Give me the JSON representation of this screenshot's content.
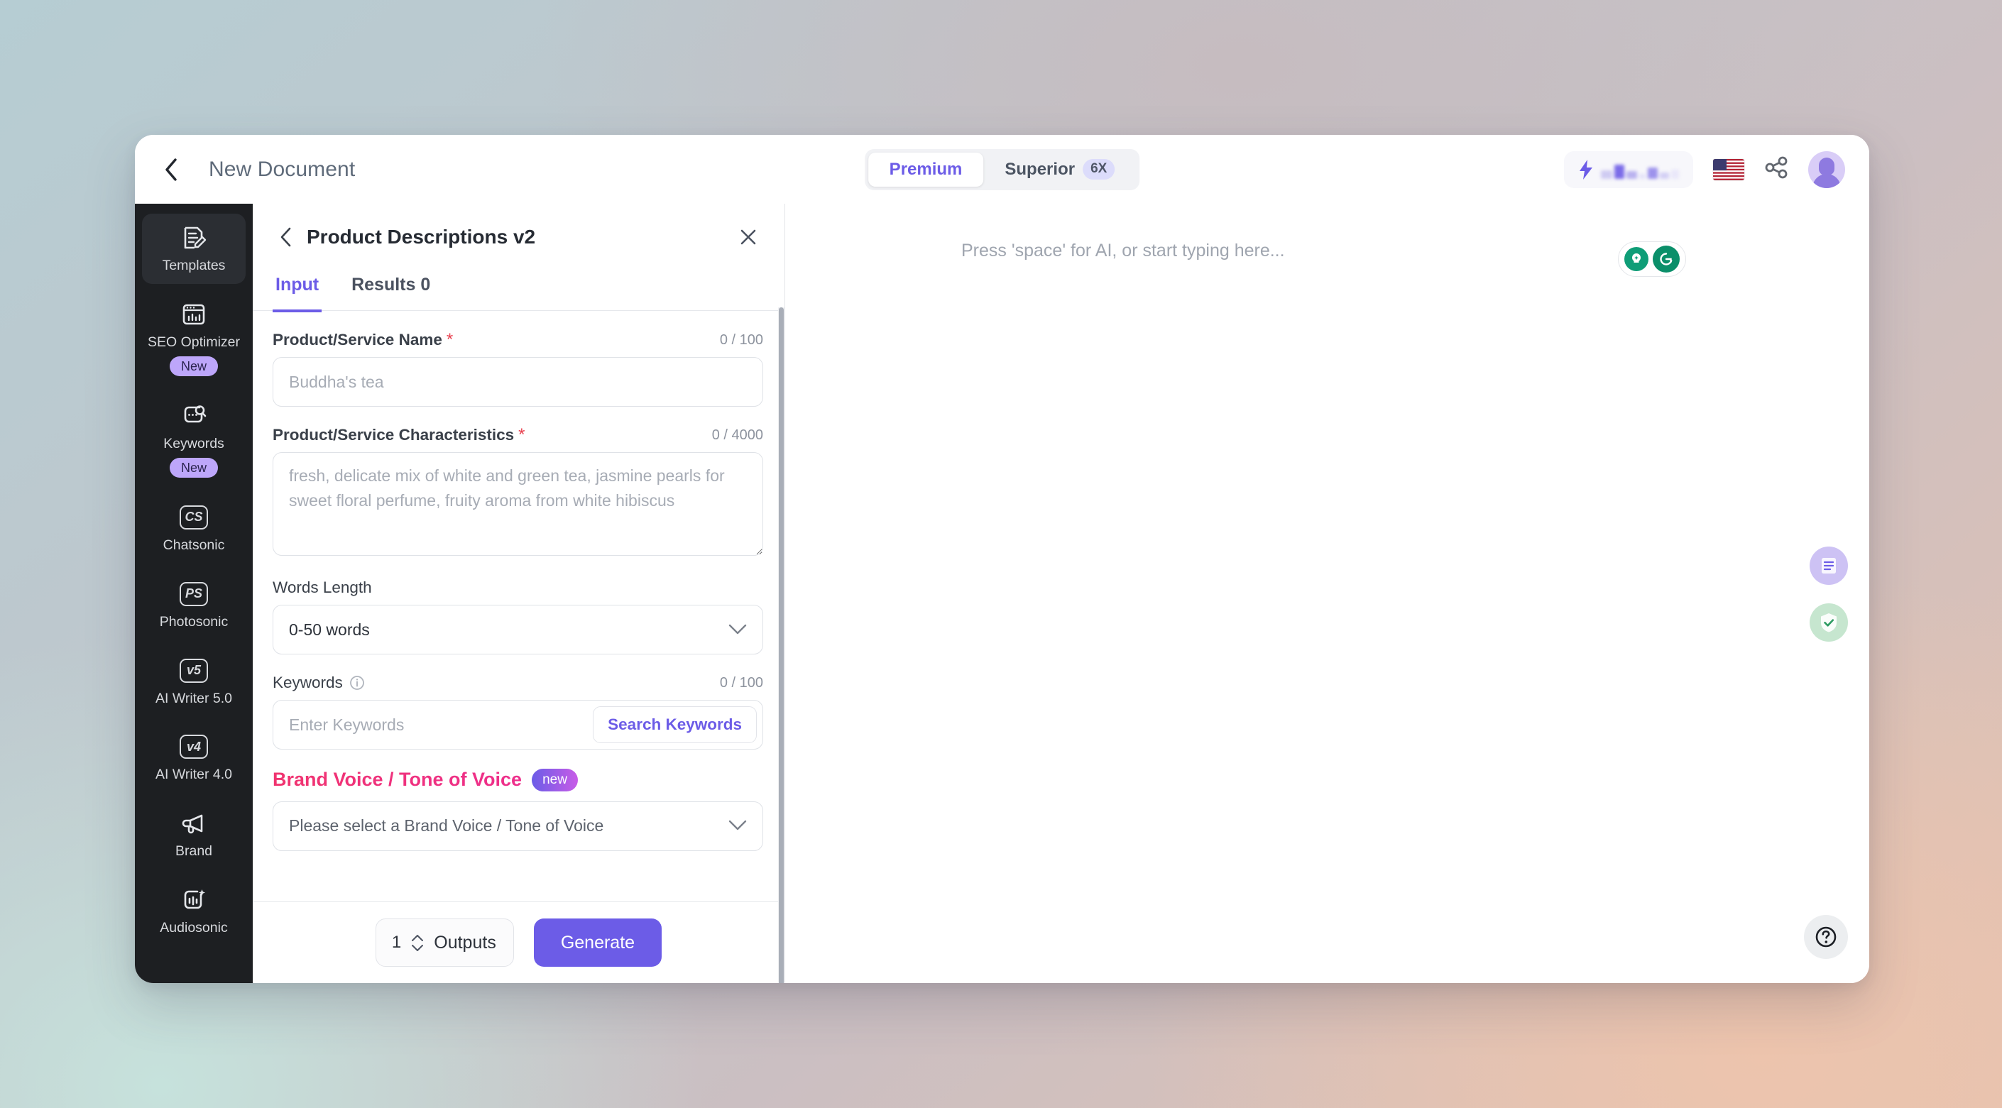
{
  "topbar": {
    "back_icon": "chevron-left-icon",
    "title": "New Document",
    "segments": [
      {
        "label": "Premium",
        "badge": "",
        "active": true
      },
      {
        "label": "Superior",
        "badge": "6X",
        "active": false
      }
    ],
    "credits_icon": "lightning-bolt-icon",
    "flag_icon": "us-flag-icon",
    "share_icon": "share-icon",
    "avatar_icon": "user-avatar"
  },
  "sidebar": {
    "items": [
      {
        "label": "Templates",
        "icon": "document-edit-icon",
        "badge": "",
        "active": true
      },
      {
        "label": "SEO Optimizer",
        "icon": "seo-chart-window-icon",
        "badge": "New",
        "active": false
      },
      {
        "label": "Keywords",
        "icon": "keyword-search-icon",
        "badge": "New",
        "active": false
      },
      {
        "label": "Chatsonic",
        "icon": "cs-box-icon",
        "glyph": "CS",
        "badge": "",
        "active": false
      },
      {
        "label": "Photosonic",
        "icon": "ps-box-icon",
        "glyph": "PS",
        "badge": "",
        "active": false
      },
      {
        "label": "AI Writer 5.0",
        "icon": "v5-box-icon",
        "glyph": "v5",
        "badge": "",
        "active": false
      },
      {
        "label": "AI Writer 4.0",
        "icon": "v4-box-icon",
        "glyph": "v4",
        "badge": "",
        "active": false
      },
      {
        "label": "Brand",
        "icon": "megaphone-icon",
        "badge": "",
        "active": false
      },
      {
        "label": "Audiosonic",
        "icon": "audio-sparkle-icon",
        "badge": "",
        "active": false
      }
    ]
  },
  "panel": {
    "back_icon": "chevron-left-icon",
    "title": "Product Descriptions v2",
    "close_icon": "close-icon",
    "tabs": [
      {
        "label": "Input",
        "active": true
      },
      {
        "label": "Results 0",
        "active": false
      }
    ],
    "fields": {
      "product_name": {
        "label": "Product/Service Name",
        "required": "*",
        "counter": "0 / 100",
        "value": "",
        "placeholder": "Buddha's tea"
      },
      "characteristics": {
        "label": "Product/Service Characteristics",
        "required": "*",
        "counter": "0 / 4000",
        "value": "",
        "placeholder": "fresh, delicate mix of white and green tea, jasmine pearls for sweet floral perfume, fruity aroma from white hibiscus"
      },
      "words_length": {
        "label": "Words Length",
        "value": "0-50 words",
        "chevron_icon": "chevron-down-icon"
      },
      "keywords": {
        "label": "Keywords",
        "info_icon": "info-icon",
        "counter": "0 / 100",
        "value": "",
        "placeholder": "Enter Keywords",
        "search_button": "Search Keywords"
      },
      "brand_voice": {
        "label": "Brand Voice / Tone of Voice",
        "badge": "new",
        "value": "Please select a Brand Voice / Tone of Voice",
        "chevron_icon": "chevron-down-icon"
      }
    },
    "footer": {
      "outputs_count": "1",
      "outputs_label": "Outputs",
      "stepper_up_icon": "chevron-up-icon",
      "stepper_down_icon": "chevron-down-icon",
      "generate_label": "Generate"
    }
  },
  "editor": {
    "placeholder": "Press 'space' for AI, or start typing here...",
    "assist_bulb_icon": "lightbulb-sparkle-icon",
    "assist_grammarly_icon": "grammarly-g-icon",
    "fabs": [
      {
        "icon": "summarize-document-icon",
        "color": "#cdc2f4"
      },
      {
        "icon": "shield-check-icon",
        "color": "#c6e6cf"
      }
    ],
    "help_icon": "question-mark-icon"
  },
  "colors": {
    "accent_purple": "#6c5ce7",
    "brand_pink": "#ee2f7f",
    "required_red": "#e8414f",
    "sidebar_dark": "#1d1f22",
    "grammarly_green": "#0b8f6a"
  }
}
